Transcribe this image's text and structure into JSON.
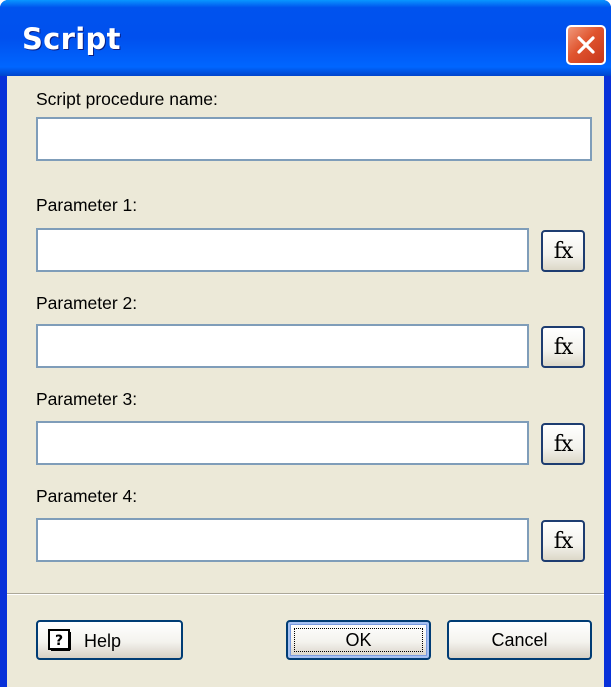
{
  "window": {
    "title": "Script"
  },
  "form": {
    "procedure_label": "Script procedure name:",
    "procedure_value": "",
    "parameters": [
      {
        "label": "Parameter 1:",
        "value": "",
        "fx_label": "fx"
      },
      {
        "label": "Parameter 2:",
        "value": "",
        "fx_label": "fx"
      },
      {
        "label": "Parameter 3:",
        "value": "",
        "fx_label": "fx"
      },
      {
        "label": "Parameter 4:",
        "value": "",
        "fx_label": "fx"
      }
    ]
  },
  "buttons": {
    "help_label": "Help",
    "ok_label": "OK",
    "cancel_label": "Cancel"
  },
  "icons": {
    "close": "close-icon",
    "help": "help-book-icon"
  },
  "colors": {
    "titlebar": "#0054e3",
    "close_button": "#e0542e",
    "dialog_background": "#ece9d8",
    "field_border": "#7f9db9"
  }
}
